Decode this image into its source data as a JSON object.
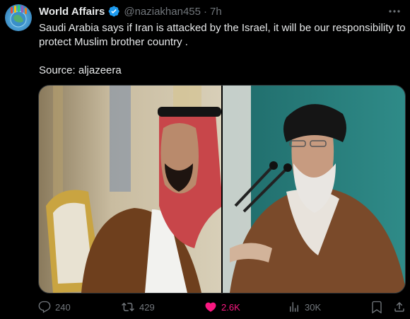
{
  "post": {
    "author_name": "World Affairs",
    "handle": "@naziakhan455",
    "separator": "·",
    "time": "7h",
    "text_line1": "Saudi Arabia says if Iran is attacked by the Israel, it will be our responsibility to protect Muslim brother country .",
    "source": "Source: aljazeera"
  },
  "actions": {
    "replies": "240",
    "reposts": "429",
    "likes": "2.6K",
    "views": "30K"
  },
  "colors": {
    "background": "#000000",
    "text": "#e7e9ea",
    "secondary": "#71767b",
    "verified": "#1d9bf0",
    "like": "#f91880"
  },
  "icons": [
    "verified-badge-icon",
    "more-icon",
    "reply-icon",
    "repost-icon",
    "like-icon",
    "views-icon",
    "bookmark-icon",
    "share-icon"
  ]
}
